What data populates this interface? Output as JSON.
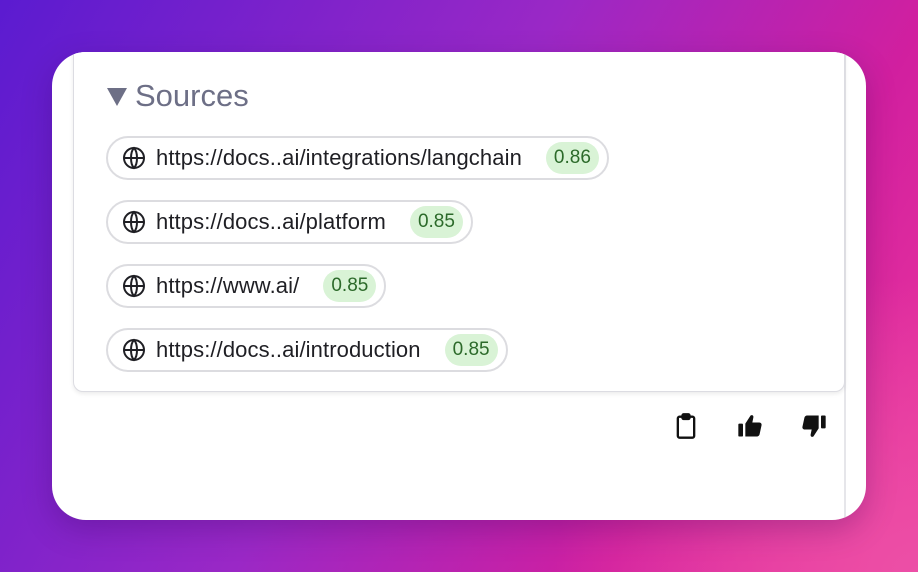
{
  "sources": {
    "header": "Sources",
    "items": [
      {
        "url": "https://docs..ai/integrations/langchain",
        "score": "0.86",
        "icon": "globe-icon"
      },
      {
        "url": "https://docs..ai/platform",
        "score": "0.85",
        "icon": "globe-icon"
      },
      {
        "url": "https://www.ai/",
        "score": "0.85",
        "icon": "globe-icon"
      },
      {
        "url": "https://docs..ai/introduction",
        "score": "0.85",
        "icon": "globe-icon"
      }
    ]
  },
  "actions": [
    {
      "icon": "clipboard-icon"
    },
    {
      "icon": "thumbs-up-icon"
    },
    {
      "icon": "thumbs-down-icon"
    }
  ],
  "colors": {
    "score_bg": "#d9f3d6",
    "score_text": "#2c6a2a",
    "header_text": "#6d6f86"
  }
}
